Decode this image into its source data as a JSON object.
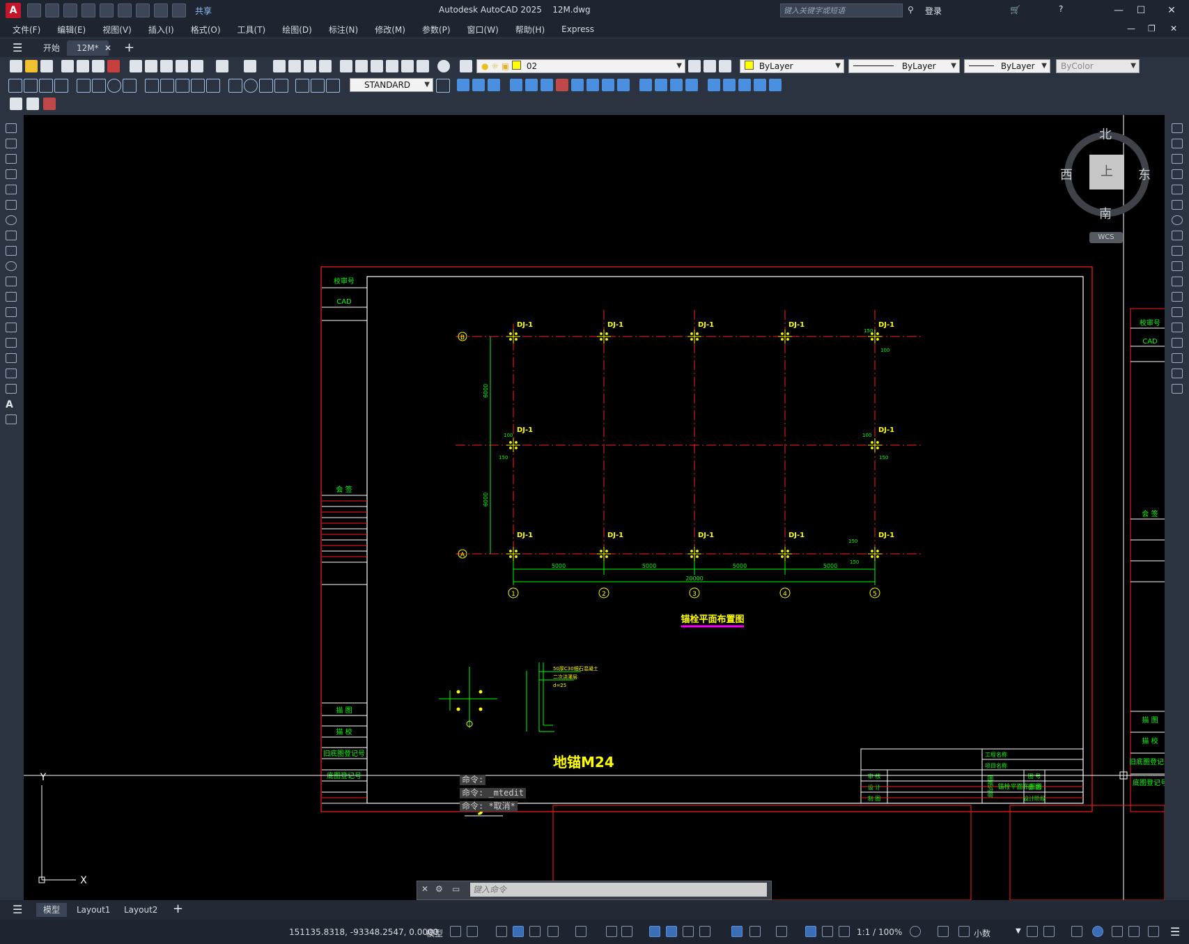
{
  "app": {
    "title": "Autodesk AutoCAD 2025",
    "file": "12M.dwg",
    "share": "共享",
    "search_placeholder": "键入关键字或短语",
    "login": "登录"
  },
  "menu": [
    "文件(F)",
    "编辑(E)",
    "视图(V)",
    "插入(I)",
    "格式(O)",
    "工具(T)",
    "绘图(D)",
    "标注(N)",
    "修改(M)",
    "参数(P)",
    "窗口(W)",
    "帮助(H)",
    "Express"
  ],
  "tabs": {
    "start": "开始",
    "doc": "12M*"
  },
  "toolbar": {
    "layer": "02",
    "color": "ByLayer",
    "linetype": "ByLayer",
    "lineweight": "ByLayer",
    "plotstyle": "ByColor",
    "dimstyle": "STANDARD"
  },
  "viewcube": {
    "north": "北",
    "south": "南",
    "east": "东",
    "west": "西",
    "top": "上",
    "wcs": "WCS"
  },
  "drawing": {
    "sheet_left": {
      "r1": "校审号",
      "r2": "CAD",
      "sign": "会 签",
      "b1": "描 图",
      "b2": "描 校",
      "b3": "旧底图登记号",
      "b4": "底图登记号"
    },
    "sheet_right": {
      "r1": "校审号",
      "r2": "CAD",
      "sign": "会 签",
      "b1": "描 图",
      "b2": "描 校",
      "b3": "旧底图登记号",
      "b4": "底图登记号"
    },
    "col_label": "DJ-1",
    "axis_rows": [
      "B",
      "A"
    ],
    "axis_cols": [
      "1",
      "2",
      "3",
      "4",
      "5"
    ],
    "dims": {
      "span": "5000",
      "total": "20000",
      "vert": "6000"
    },
    "dims_small": [
      "150",
      "100"
    ],
    "plan_title": "锚栓平面布置图",
    "detail_label": "DJ-1",
    "anchor_label": "地锚M24",
    "anchor_notes": [
      "50厚C30细石混凝土",
      "二次浇灌层",
      "d=25"
    ],
    "titleblock": {
      "project": "工程名称",
      "item": "项目名称",
      "drawing_name": "锚栓平面布置图",
      "rows": [
        "审 核",
        "设 计",
        "制 图"
      ],
      "right": [
        "图 号",
        "日 期",
        "设计阶段"
      ],
      "mid": "图纸内容"
    }
  },
  "command": {
    "line1": "命令:",
    "line2": "命令: _mtedit",
    "line3": "命令: *取消*",
    "placeholder": "键入命令"
  },
  "ucs": {
    "x": "X",
    "y": "Y"
  },
  "layouts": [
    "模型",
    "Layout1",
    "Layout2"
  ],
  "status": {
    "coords": "151135.8318, -93348.2547, 0.0000",
    "mode": "模型",
    "scale": "1:1 / 100%",
    "units": "小数"
  }
}
